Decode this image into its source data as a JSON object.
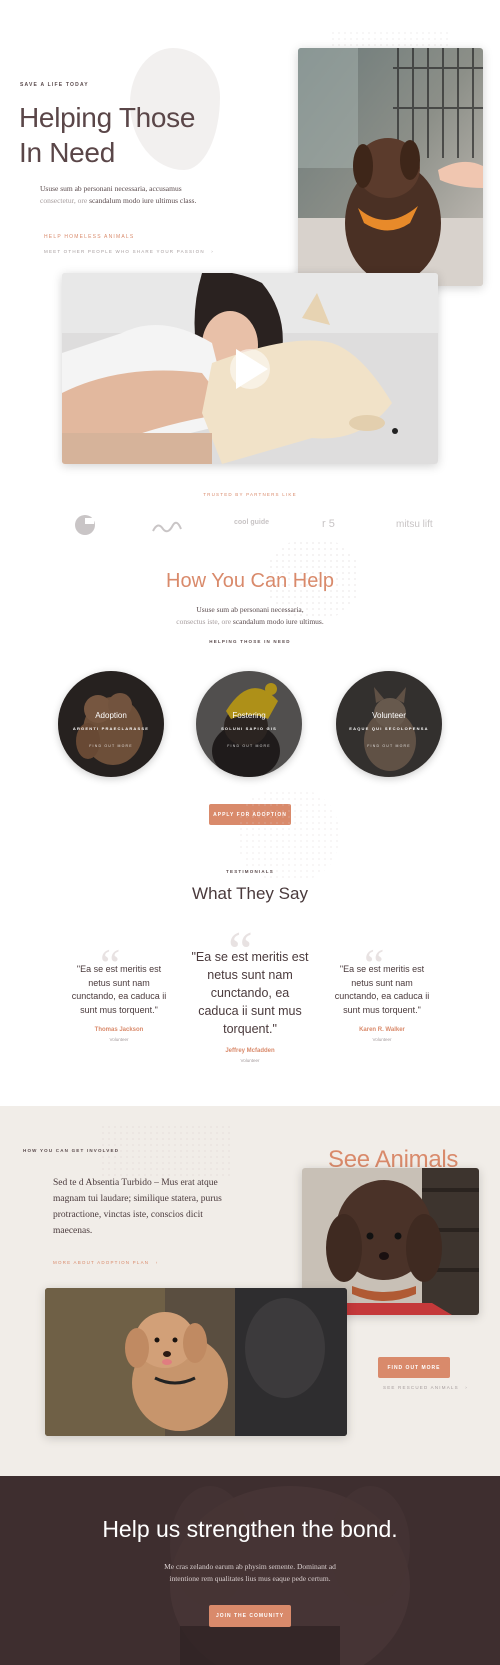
{
  "hero": {
    "eyebrow": "SAVE A LIFE TODAY",
    "title_line1": "Helping Those",
    "title_line2": "In Need",
    "body_pre": "Ususe sum ab personani necessaria, accusamus ",
    "body_muted": "consectetur, ore",
    "body_post": " scandalum modo iure ultimus class.",
    "link_primary": "HELP HOMELESS ANIMALS",
    "link_secondary": "MEET OTHER PEOPLE WHO SHARE YOUR PASSION",
    "arrow": "›"
  },
  "video": {
    "play_icon": "play-icon"
  },
  "partners": {
    "label": "TRUSTED BY PARTNERS LIKE",
    "logos": [
      "e",
      "~",
      "cool guide",
      "r 5",
      "mitsu lift"
    ]
  },
  "help": {
    "title": "How You Can Help",
    "body_line1": "Ususe sum ab personani necessaria,",
    "body_line2_muted": "consectus iste, ore",
    "body_line2_post": " scandalum modo iure ultimus.",
    "eyebrow": "HELPING THOSE IN NEED",
    "cards": [
      {
        "title": "Adoption",
        "subtitle": "ARGENTI PRAECLARASSE",
        "cta": "FIND OUT MORE"
      },
      {
        "title": "Fostering",
        "subtitle": "SOLUNI SAPIO GIS",
        "cta": "FIND OUT MORE"
      },
      {
        "title": "Volunteer",
        "subtitle": "EAQUE QUI SECOLOPENSA",
        "cta": "FIND OUT MORE"
      }
    ],
    "button": "APPLY FOR ADOPTION"
  },
  "testimonials": {
    "eyebrow": "TESTIMONIALS",
    "title": "What They Say",
    "items": [
      {
        "quote": "\"Ea se est meritis est netus sunt nam cunctando, ea caduca ii sunt mus torquent.\"",
        "name": "Thomas Jackson",
        "role": "Volunteer"
      },
      {
        "quote": "\"Ea se est meritis est netus sunt nam cunctando, ea caduca ii sunt mus torquent.\"",
        "name": "Jeffrey Mcfadden",
        "role": "Volunteer"
      },
      {
        "quote": "\"Ea se est meritis est netus sunt nam cunctando, ea caduca ii sunt mus torquent.\"",
        "name": "Karen R. Walker",
        "role": "Volunteer"
      }
    ]
  },
  "involved": {
    "eyebrow": "HOW YOU CAN GET INVOLVED",
    "heading": "See Animals",
    "body": "Sed te d Absentia Turbido – Mus erat atque magnam tui laudare; similique statera, purus protractione, vinctas iste, conscios dicit maecenas.",
    "link": "MORE ABOUT ADOPTION PLAN",
    "button": "FIND OUT MORE",
    "link_secondary": "SEE RESCUED ANIMALS",
    "arrow": "›"
  },
  "footer_cta": {
    "title": "Help us strengthen the bond.",
    "body_line1": "Me cras zelando earum ab physim semente. Dominant ad",
    "body_line2": "intentione rem qualitates lius mus eaque pede certum.",
    "button": "JOIN THE COMUNITY"
  },
  "colors": {
    "accent": "#d98a6b",
    "text": "#4a3a3c",
    "beige": "#f1ede8",
    "dark": "#3e2e2f"
  }
}
